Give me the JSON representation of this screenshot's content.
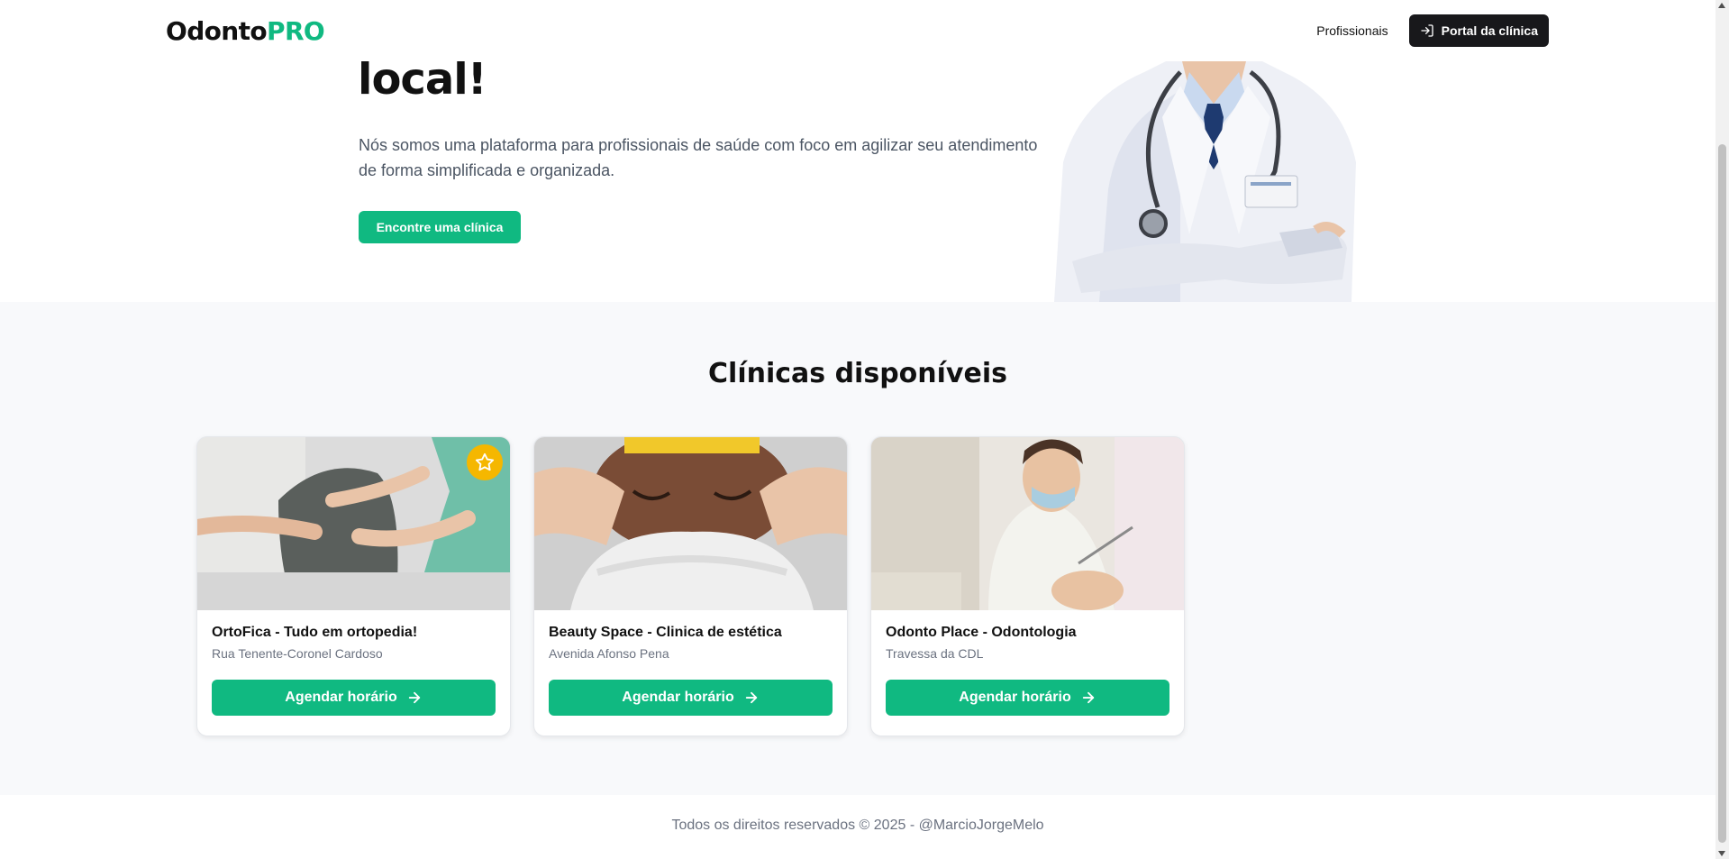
{
  "header": {
    "logo_main": "Odonto",
    "logo_accent": "PRO",
    "nav_professionals": "Profissionais",
    "portal_button": "Portal da clínica"
  },
  "hero": {
    "title": "local!",
    "description": "Nós somos uma plataforma para profissionais de saúde com foco em agilizar seu atendimento de forma simplificada e organizada.",
    "cta": "Encontre uma clínica"
  },
  "clinics": {
    "title": "Clínicas disponíveis",
    "items": [
      {
        "name": "OrtoFica - Tudo em ortopedia!",
        "address": "Rua Tenente-Coronel Cardoso",
        "button": "Agendar horário",
        "featured": true
      },
      {
        "name": "Beauty Space - Clinica de estética",
        "address": "Avenida Afonso Pena",
        "button": "Agendar horário",
        "featured": false
      },
      {
        "name": "Odonto Place - Odontologia",
        "address": "Travessa da CDL",
        "button": "Agendar horário",
        "featured": false
      }
    ]
  },
  "footer": {
    "text": "Todos os direitos reservados © 2025 - @MarcioJorgeMelo"
  },
  "colors": {
    "accent": "#10b981",
    "dark_button": "#18181b",
    "star_badge": "#f5b700",
    "section_bg": "#f8f9fb"
  },
  "icons": {
    "portal": "log-in-icon",
    "arrow": "arrow-right-icon",
    "star": "star-icon"
  }
}
